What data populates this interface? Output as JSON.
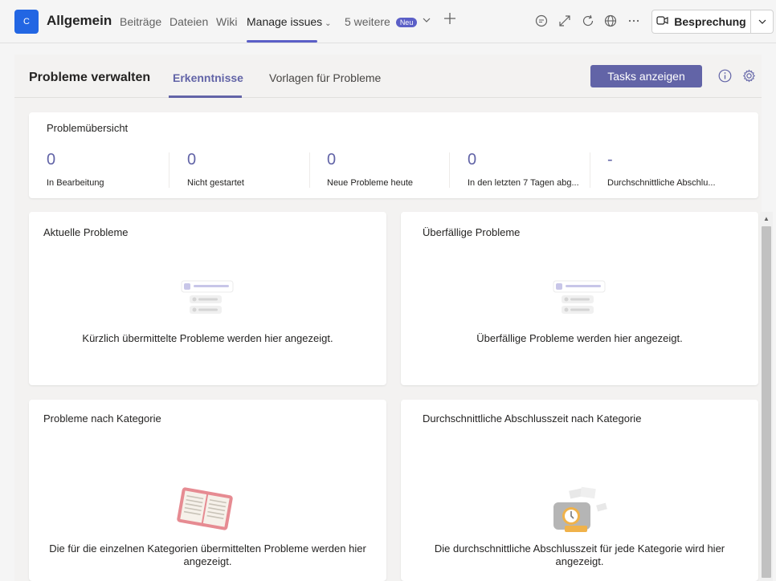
{
  "topbar": {
    "team_initial": "C",
    "channel": "Allgemein",
    "tabs": [
      "Beiträge",
      "Dateien",
      "Wiki"
    ],
    "active_tab": "Manage issues",
    "more_tabs": "5 weitere",
    "new_badge": "Neu",
    "meeting_button": "Besprechung",
    "icons": [
      "chat-icon",
      "expand-icon",
      "refresh-icon",
      "globe-icon",
      "more-icon",
      "video-icon",
      "chevron-down-icon"
    ]
  },
  "app": {
    "title": "Probleme verwalten",
    "tabs": [
      "Erkenntnisse",
      "Vorlagen für Probleme"
    ],
    "tasks_button": "Tasks anzeigen",
    "accent_color": "#6264a7"
  },
  "overview": {
    "title": "Problemübersicht",
    "stats": [
      {
        "value": "0",
        "label": "In Bearbeitung"
      },
      {
        "value": "0",
        "label": "Nicht gestartet"
      },
      {
        "value": "0",
        "label": "Neue Probleme heute"
      },
      {
        "value": "0",
        "label": "In den letzten 7 Tagen abg..."
      },
      {
        "value": "-",
        "label": "Durchschnittliche Abschlu..."
      }
    ]
  },
  "cards": {
    "current": {
      "title": "Aktuelle Probleme",
      "empty": "Kürzlich übermittelte Probleme werden hier angezeigt."
    },
    "overdue": {
      "title": "Überfällige Probleme",
      "empty": "Überfällige Probleme werden hier angezeigt."
    },
    "by_category": {
      "title": "Probleme nach Kategorie",
      "empty": "Die für die einzelnen Kategorien übermittelten Probleme werden hier angezeigt."
    },
    "avg_time": {
      "title": "Durchschnittliche Abschlusszeit nach Kategorie",
      "empty": "Die durchschnittliche Abschlusszeit für jede Kategorie wird hier angezeigt."
    }
  }
}
